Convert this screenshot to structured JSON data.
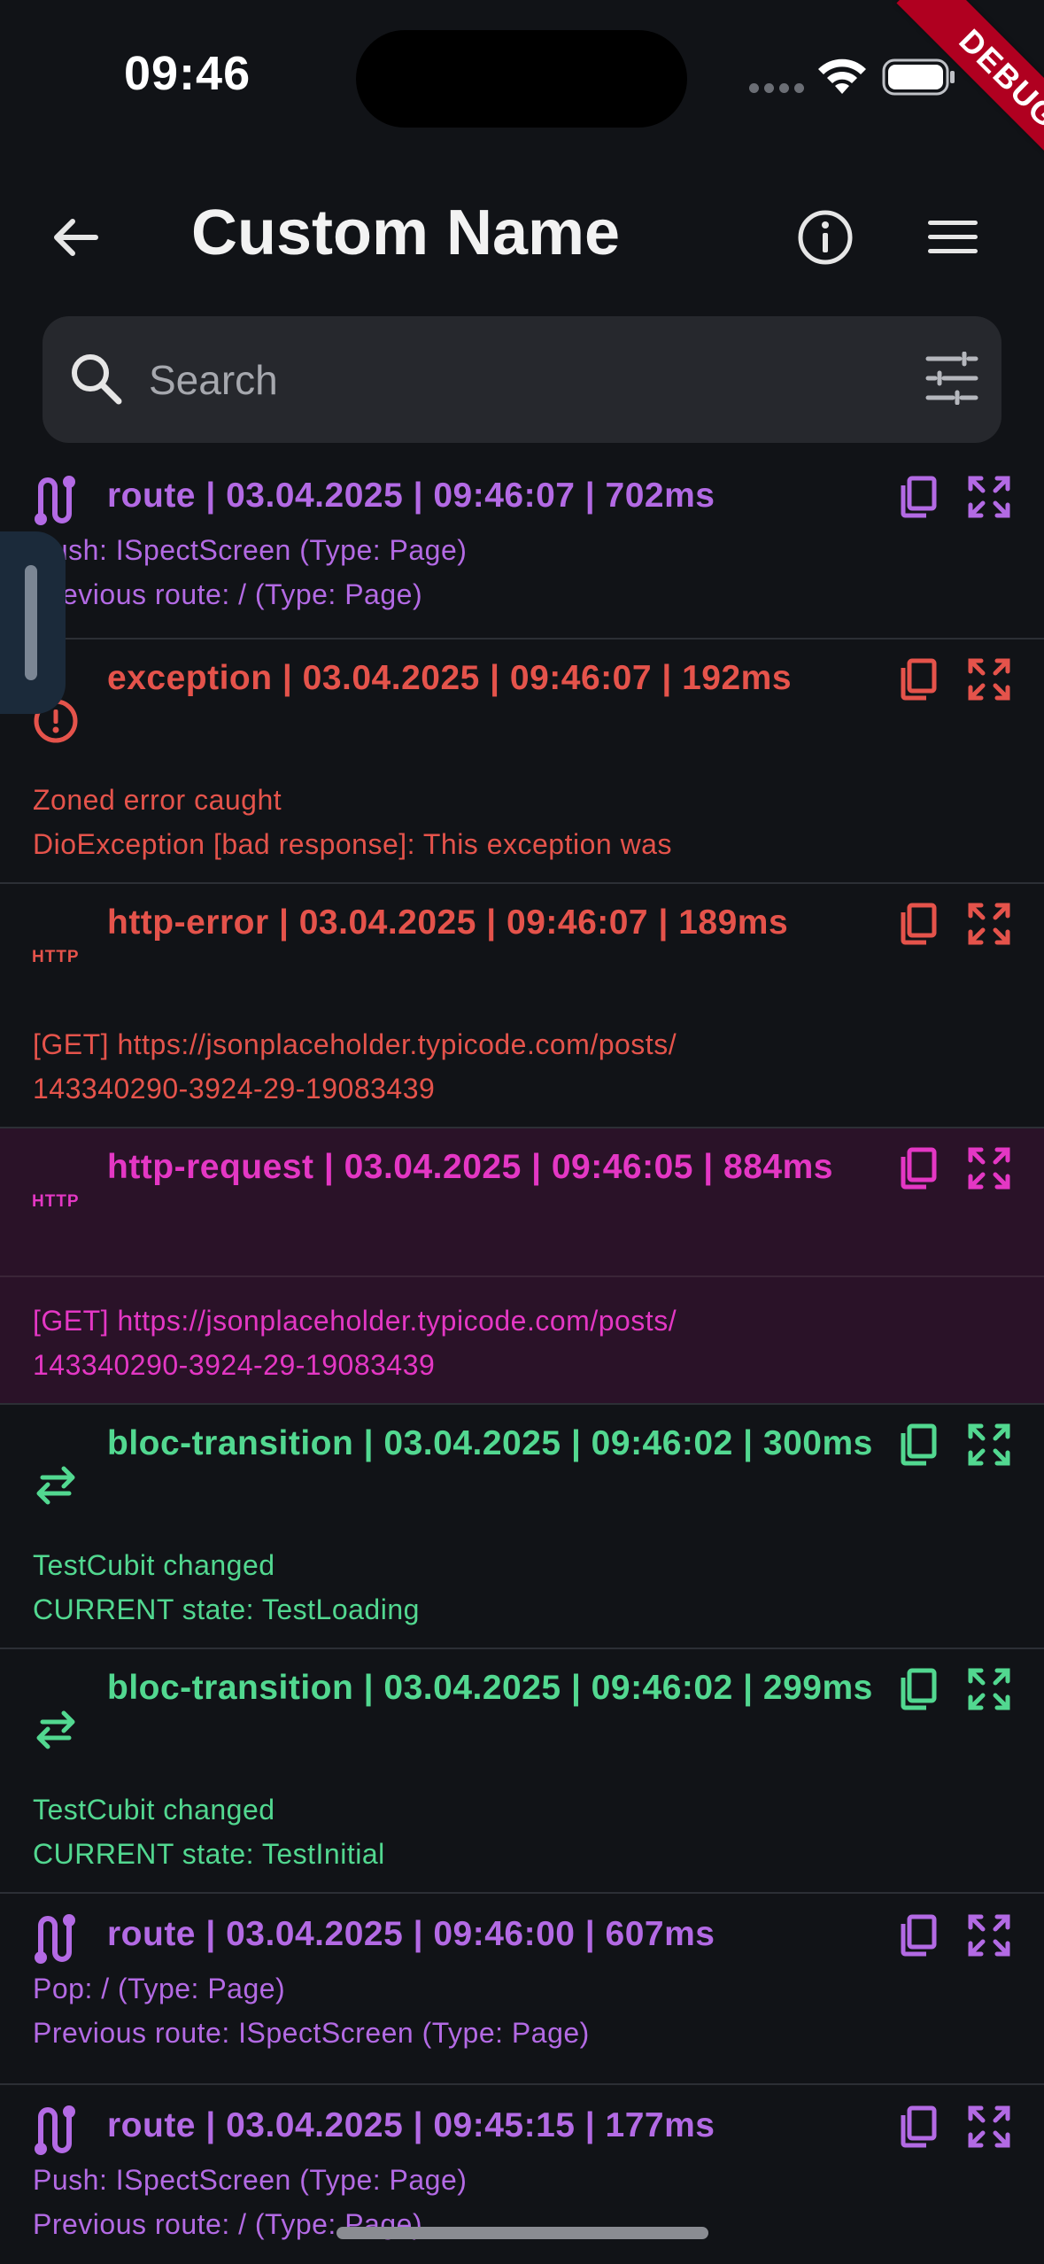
{
  "status_bar": {
    "time": "09:46",
    "debug_label": "DEBUG"
  },
  "app_bar": {
    "title": "Custom Name"
  },
  "search": {
    "placeholder": "Search"
  },
  "colors": {
    "route": "#b36ae4",
    "error": "#e5534b",
    "http_request": "#e437c4",
    "bloc": "#52d890",
    "background": "#111317"
  },
  "logs": [
    {
      "type": "route",
      "icon": "route-icon",
      "title": "route | 03.04.2025 | 09:46:07 | 702ms",
      "lines": [
        "Push: ISpectScreen (Type: Page)",
        "Previous route: / (Type: Page)"
      ]
    },
    {
      "type": "exception",
      "icon": "exclamation-circle-icon",
      "title": "exception | 03.04.2025 | 09:46:07 | 192ms",
      "lines": [
        "Zoned error caught",
        "DioException [bad response]: This exception was"
      ]
    },
    {
      "type": "http-error",
      "icon": "http-icon",
      "icon_label": "HTTP",
      "title": "http-error | 03.04.2025 | 09:46:07 | 189ms",
      "lines": [
        "[GET] https://jsonplaceholder.typicode.com/posts/",
        "143340290-3924-29-19083439"
      ]
    },
    {
      "type": "http-request",
      "icon": "http-icon",
      "icon_label": "HTTP",
      "title": "http-request | 03.04.2025 | 09:46:05 | 884ms",
      "lines": [
        "[GET] https://jsonplaceholder.typicode.com/posts/",
        "143340290-3924-29-19083439"
      ]
    },
    {
      "type": "bloc-transition",
      "icon": "swap-arrows-icon",
      "title": "bloc-transition | 03.04.2025 | 09:46:02 | 300ms",
      "lines": [
        "TestCubit changed",
        "CURRENT state: TestLoading"
      ]
    },
    {
      "type": "bloc-transition",
      "icon": "swap-arrows-icon",
      "title": "bloc-transition | 03.04.2025 | 09:46:02 | 299ms",
      "lines": [
        "TestCubit changed",
        "CURRENT state: TestInitial"
      ]
    },
    {
      "type": "route",
      "icon": "route-icon",
      "title": "route | 03.04.2025 | 09:46:00 | 607ms",
      "lines": [
        "Pop: / (Type: Page)",
        "Previous route: ISpectScreen (Type: Page)"
      ]
    },
    {
      "type": "route",
      "icon": "route-icon",
      "title": "route | 03.04.2025 | 09:45:15 | 177ms",
      "lines": [
        "Push: ISpectScreen (Type: Page)",
        "Previous route: / (Type: Page)"
      ]
    }
  ]
}
